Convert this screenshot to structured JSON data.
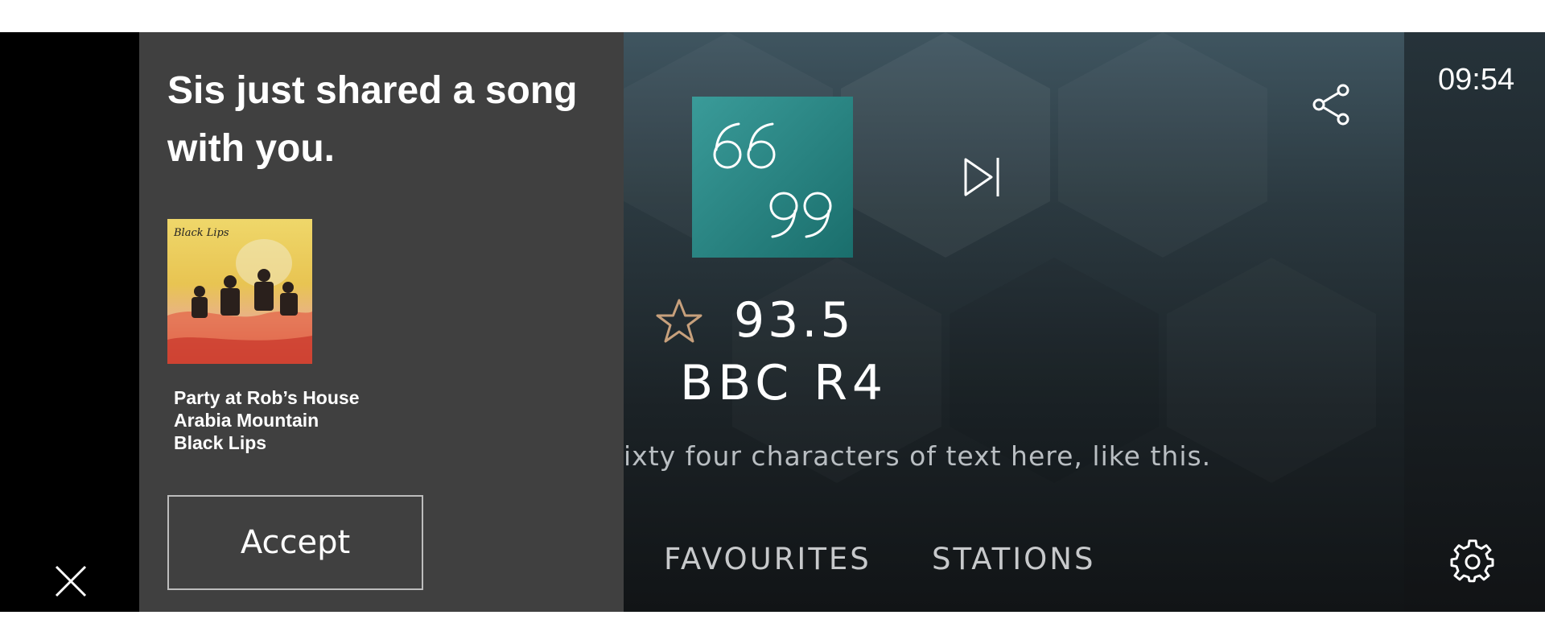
{
  "notification": {
    "title": "Sis just shared a song with you.",
    "song": {
      "title": "Party at Rob’s House",
      "album": "Arabia Mountain",
      "artist": "Black Lips"
    },
    "album_art_text": "Black Lips",
    "accept_label": "Accept"
  },
  "radio": {
    "frequency": "93.5",
    "station": "BBC R4",
    "rds_text": "ixty four characters of text here, like this."
  },
  "tabs": {
    "favourites": "FAVOURITES",
    "stations": "STATIONS"
  },
  "status": {
    "time": "09:54"
  },
  "icons": {
    "close": "close-icon",
    "share": "share-icon",
    "skip": "skip-next-icon",
    "star": "star-outline-icon",
    "quote": "quote-icon",
    "settings": "gear-icon"
  },
  "colors": {
    "panel": "#404040",
    "star": "#c7a07c",
    "logo": "#2a8a88"
  }
}
